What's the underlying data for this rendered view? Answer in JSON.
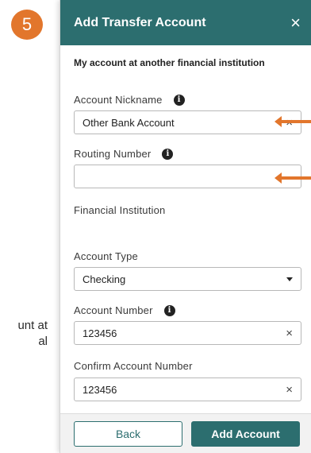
{
  "step_badge": "5",
  "background_text": [
    "unt at",
    "al"
  ],
  "modal": {
    "title": "Add Transfer Account",
    "close_label": "×",
    "section_heading": "My account at another financial institution",
    "account_nickname": {
      "label": "Account Nickname",
      "value": "Other Bank Account",
      "info_icon": "i",
      "clear_label": "×"
    },
    "routing_number": {
      "label": "Routing Number",
      "value": "",
      "info_icon": "i"
    },
    "financial_institution": {
      "label": "Financial Institution"
    },
    "account_type": {
      "label": "Account Type",
      "value": "Checking"
    },
    "account_number": {
      "label": "Account Number",
      "value": "123456",
      "info_icon": "i",
      "clear_label": "×"
    },
    "confirm_account_number": {
      "label": "Confirm Account Number",
      "value": "123456",
      "clear_label": "×"
    },
    "buttons": {
      "back": "Back",
      "add": "Add Account"
    }
  },
  "colors": {
    "accent": "#2c6e6f",
    "annotation": "#e2762c"
  }
}
